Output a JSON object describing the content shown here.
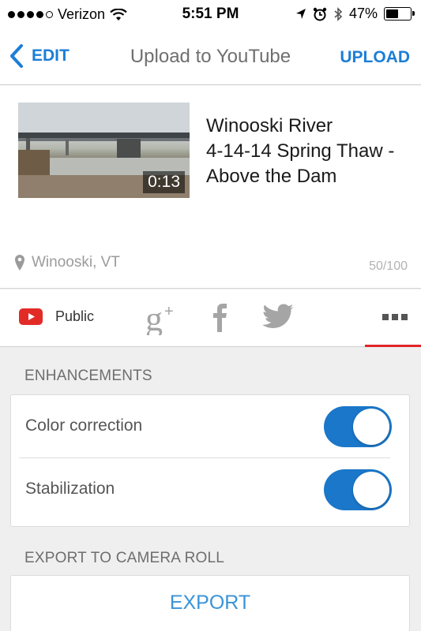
{
  "status_bar": {
    "carrier": "Verizon",
    "time": "5:51 PM",
    "battery_percent": "47%",
    "battery_level": 0.47,
    "signal_bars_filled": 4,
    "signal_bars_total": 5
  },
  "nav": {
    "back_label": "EDIT",
    "title": "Upload to YouTube",
    "upload_label": "UPLOAD",
    "accent_color": "#1c7ed6"
  },
  "video": {
    "duration": "0:13",
    "title": "Winooski River\n4-14-14 Spring Thaw -\nAbove the Dam",
    "location": "Winooski, VT",
    "char_count": "50/100"
  },
  "share": {
    "privacy_label": "Public",
    "icons": [
      "youtube-icon",
      "google-plus-icon",
      "facebook-icon",
      "twitter-icon",
      "more-icon"
    ],
    "active_indicator_color": "#e0252a"
  },
  "enhancements": {
    "header": "ENHANCEMENTS",
    "items": [
      {
        "label": "Color correction",
        "enabled": true
      },
      {
        "label": "Stabilization",
        "enabled": true
      }
    ],
    "toggle_color": "#1b77c9"
  },
  "export": {
    "header": "EXPORT TO CAMERA ROLL",
    "button_label": "EXPORT"
  }
}
